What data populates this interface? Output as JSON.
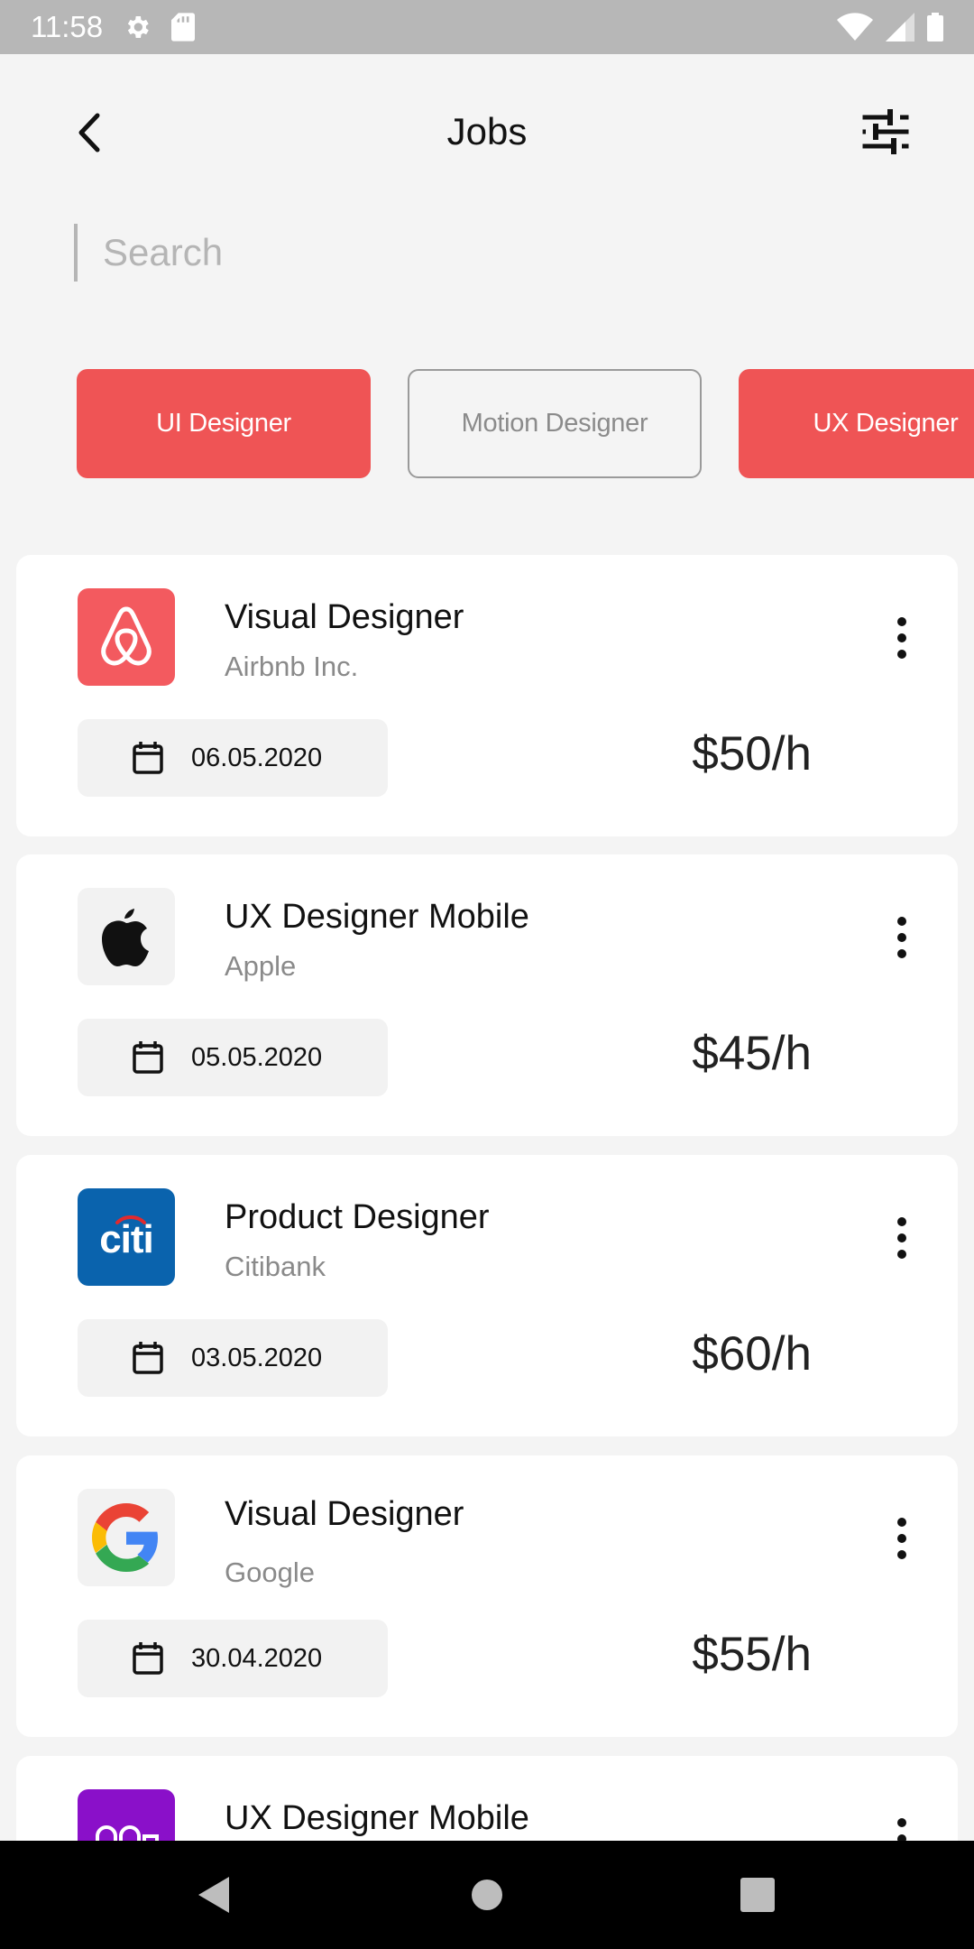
{
  "status_bar": {
    "time": "11:58"
  },
  "header": {
    "title": "Jobs"
  },
  "search": {
    "placeholder": "Search"
  },
  "chips": [
    {
      "label": "UI Designer",
      "active": true
    },
    {
      "label": "Motion Designer",
      "active": false
    },
    {
      "label": "UX Designer",
      "active": true
    }
  ],
  "jobs": [
    {
      "title": "Visual Designer",
      "company": "Airbnb Inc.",
      "date": "06.05.2020",
      "rate": "$50/h",
      "logo": "airbnb-logo",
      "logo_color": "#f35a5f"
    },
    {
      "title": "UX Designer Mobile",
      "company": "Apple",
      "date": "05.05.2020",
      "rate": "$45/h",
      "logo": "apple-logo",
      "logo_color": "#f2f2f2"
    },
    {
      "title": "Product Designer",
      "company": "Citibank",
      "date": "03.05.2020",
      "rate": "$60/h",
      "logo": "citi-logo",
      "logo_color": "#0a63ad",
      "logo_text": "citi"
    },
    {
      "title": "Visual Designer",
      "company": "Google",
      "date": "30.04.2020",
      "rate": "$55/h",
      "logo": "google-logo",
      "logo_color": "#f2f2f2"
    },
    {
      "title": "UX Designer Mobile",
      "company": "",
      "date": "",
      "rate": "",
      "logo": "purple-logo",
      "logo_color": "#8a10c9"
    }
  ],
  "colors": {
    "accent": "#ef5455",
    "background": "#f4f4f4",
    "card": "#ffffff"
  }
}
